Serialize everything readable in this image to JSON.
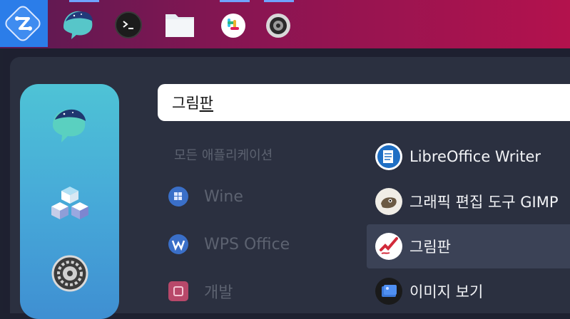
{
  "taskbar": {
    "items": [
      {
        "name": "start-menu",
        "icon": "launcher-icon"
      },
      {
        "name": "whale-browser",
        "icon": "whale-icon"
      },
      {
        "name": "terminal",
        "icon": "terminal-icon"
      },
      {
        "name": "files",
        "icon": "folder-icon"
      },
      {
        "name": "slack",
        "icon": "slack-icon"
      },
      {
        "name": "audio",
        "icon": "speaker-icon"
      }
    ]
  },
  "sidebar": {
    "items": [
      {
        "name": "whale",
        "icon": "whale-icon"
      },
      {
        "name": "packages",
        "icon": "cubes-icon"
      },
      {
        "name": "settings",
        "icon": "gear-icon"
      }
    ]
  },
  "search": {
    "value_plain": "그림",
    "value_underlined": "판"
  },
  "categories": {
    "header": "모든 애플리케이션",
    "items": [
      {
        "label": "Wine",
        "icon": "wine-icon",
        "color": "#3a6fc8"
      },
      {
        "label": "WPS Office",
        "icon": "wps-icon",
        "color": "#3a6fc8"
      },
      {
        "label": "개발",
        "icon": "dev-icon",
        "color": "#b8486a"
      }
    ]
  },
  "apps": {
    "items": [
      {
        "label": "LibreOffice Writer",
        "icon": "writer-icon"
      },
      {
        "label": "그래픽 편집 도구 GIMP",
        "icon": "gimp-icon"
      },
      {
        "label": "그림판",
        "icon": "paint-icon",
        "selected": true
      },
      {
        "label": "이미지 보기",
        "icon": "image-viewer-icon"
      }
    ]
  },
  "colors": {
    "accent": "#2b7de9",
    "taskbar_start": "#5a1a52",
    "taskbar_end": "#b3124d",
    "panel": "#2b3040",
    "sidebar": "#46a7d8",
    "selection": "#3b4256"
  }
}
